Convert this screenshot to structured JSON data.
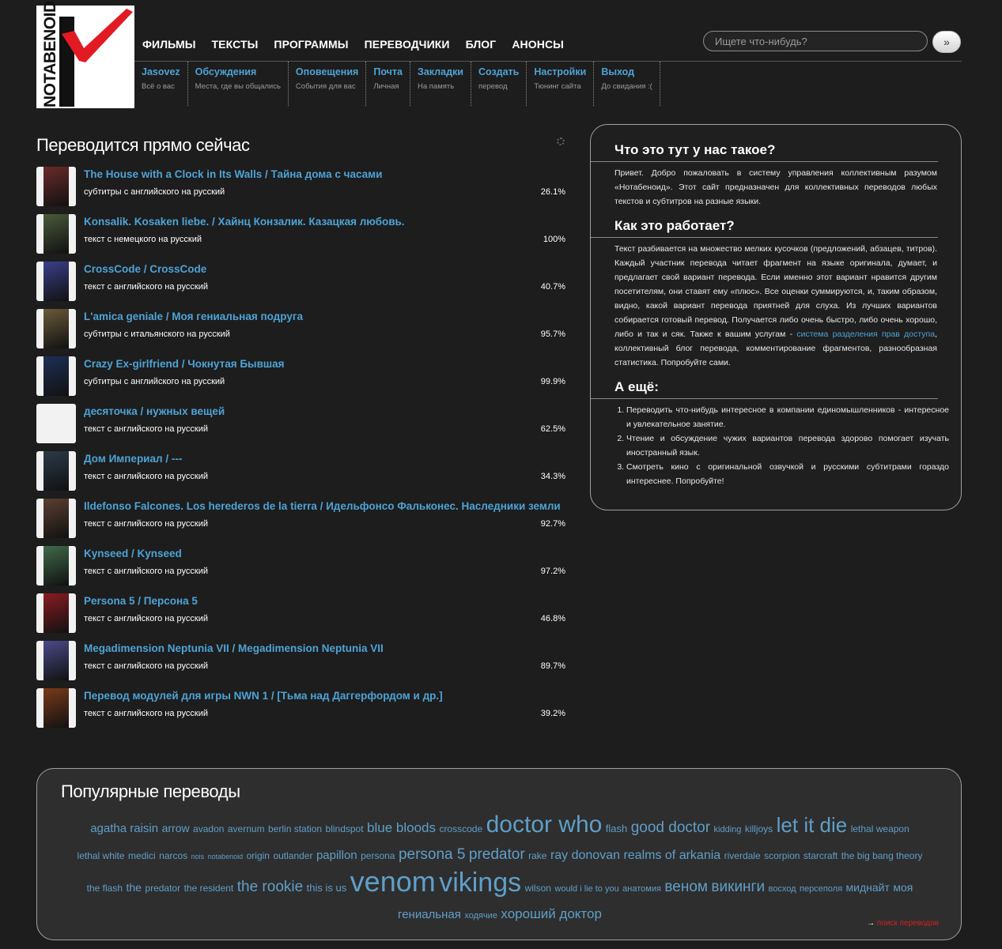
{
  "logo": {
    "text": "NOTABENOID"
  },
  "nav": [
    "ФИЛЬМЫ",
    "ТЕКСТЫ",
    "ПРОГРАММЫ",
    "ПЕРЕВОДЧИКИ",
    "БЛОГ",
    "АНОНСЫ"
  ],
  "search": {
    "placeholder": "Ищете что-нибудь?",
    "button": "»"
  },
  "subnav": [
    {
      "title": "Jasovez",
      "desc": "Всё о вас"
    },
    {
      "title": "Обсуждения",
      "desc": "Места, где вы общались"
    },
    {
      "title": "Оповещения",
      "desc": "События для вас"
    },
    {
      "title": "Почта",
      "desc": "Личная"
    },
    {
      "title": "Закладки",
      "desc": "На память"
    },
    {
      "title": "Создать",
      "desc": "перевод"
    },
    {
      "title": "Настройки",
      "desc": "Тюнинг сайта"
    },
    {
      "title": "Выход",
      "desc": "До свидания :("
    }
  ],
  "translating": {
    "heading": "Переводится прямо сейчас",
    "items": [
      {
        "title": "The House with a Clock in Its Walls / Тайна дома с часами",
        "sub": "субтитры с английского на русский",
        "pct": "26.1%",
        "color": "#6b2a2a"
      },
      {
        "title": "Konsalik. Kosaken liebe. / Хайнц Конзалик. Казацкая любовь.",
        "sub": "текст с немецкого на русский",
        "pct": "100%",
        "color": "#4a5a3a"
      },
      {
        "title": "CrossCode / CrossCode",
        "sub": "текст с английского на русский",
        "pct": "40.7%",
        "color": "#3b3f8a"
      },
      {
        "title": "L'amica geniale / Моя гениальная подруга",
        "sub": "субтитры с итальянского на русский",
        "pct": "95.7%",
        "color": "#6a5a3a"
      },
      {
        "title": "Crazy Ex-girlfriend / Чокнутая Бывшая",
        "sub": "субтитры с английского на русский",
        "pct": "99.9%",
        "color": "#1e2f56"
      },
      {
        "title": "десяточка / нужных вещей",
        "sub": "текст с английского на русский",
        "pct": "62.5%",
        "color": ""
      },
      {
        "title": "Дом Империал / ---",
        "sub": "текст с английского на русский",
        "pct": "34.3%",
        "color": "#2c3a4a"
      },
      {
        "title": "Ildefonso Falcones. Los herederos de la tierra / Идельфонсо Фальконес. Наследники земли",
        "sub": "текст с английского на русский",
        "pct": "92.7%",
        "color": "#5a3f30"
      },
      {
        "title": "Kynseed / Kynseed",
        "sub": "текст с английского на русский",
        "pct": "97.2%",
        "color": "#3f6a4a"
      },
      {
        "title": "Persona 5 / Персона 5",
        "sub": "текст с английского на русский",
        "pct": "46.8%",
        "color": "#8a1c22"
      },
      {
        "title": "Megadimension Neptunia VII / Megadimension Neptunia VII",
        "sub": "текст с английского на русский",
        "pct": "89.7%",
        "color": "#4a4a8a"
      },
      {
        "title": "Перевод модулей для игры NWN 1 / [Тьма над Даггерфордом и др.]",
        "sub": "текст с английского на русский",
        "pct": "39.2%",
        "color": "#7a3a1a"
      }
    ]
  },
  "info": {
    "h1": "Что это тут у нас такое?",
    "p1": "Привет. Добро пожаловать в систему управления коллективным разумом «Нотабеноид». Этот сайт предназначен для коллективных переводов любых текстов и субтитров на разные языки.",
    "h2": "Как это работает?",
    "p2a": "Текст разбивается на множество мелких кусочков (предложений, абзацев, титров). Каждый участник перевода читает фрагмент на языке оригинала, думает, и предлагает свой вариант перевода. Если именно этот вариант нравится другим посетителям, они ставят ему «плюс». Все оценки суммируются, и, таким образом, видно, какой вариант перевода приятней для слуха. Из лучших вариантов собирается готовый перевод. Получается либо очень быстро, либо очень хорошо, либо и так и сяк. Также к вашим услугам -",
    "p2link": "система разделения прав доступа",
    "p2b": ", коллективный блог перевода, комментирование фрагментов, разнообразная статистика. Попробуйте сами.",
    "h3": "А ещё:",
    "list": [
      "Переводить что-нибудь интересное в компании единомышленников - интересное и увлекательное занятие.",
      "Чтение и обсуждение чужих вариантов перевода здорово помогает изучать иностранный язык.",
      "Смотреть кино с оригинальной озвучкой и русскими субтитрами гораздо интереснее. Попробуйте!"
    ]
  },
  "popular": {
    "heading": "Популярные переводы",
    "tags": [
      {
        "t": "agatha raisin",
        "s": 15
      },
      {
        "t": "arrow",
        "s": 14
      },
      {
        "t": "avadon",
        "s": 12
      },
      {
        "t": "avernum",
        "s": 12
      },
      {
        "t": "berlin station",
        "s": 12
      },
      {
        "t": "blindspot",
        "s": 12
      },
      {
        "t": "blue bloods",
        "s": 17
      },
      {
        "t": "crosscode",
        "s": 12
      },
      {
        "t": "doctor who",
        "s": 30
      },
      {
        "t": "flash",
        "s": 13
      },
      {
        "t": "good doctor",
        "s": 19
      },
      {
        "t": "kidding",
        "s": 11
      },
      {
        "t": "killjoys",
        "s": 12
      },
      {
        "t": "let it die",
        "s": 26
      },
      {
        "t": "lethal weapon",
        "s": 12
      },
      {
        "t": "lethal white",
        "s": 12
      },
      {
        "t": "medici",
        "s": 12
      },
      {
        "t": "narcos",
        "s": 12
      },
      {
        "t": "nois",
        "s": 9
      },
      {
        "t": "notabenoid",
        "s": 9
      },
      {
        "t": "origin",
        "s": 12
      },
      {
        "t": "outlander",
        "s": 12
      },
      {
        "t": "papillon",
        "s": 15
      },
      {
        "t": "persona",
        "s": 12
      },
      {
        "t": "persona 5",
        "s": 19
      },
      {
        "t": "predator",
        "s": 19
      },
      {
        "t": "rake",
        "s": 12
      },
      {
        "t": "ray donovan",
        "s": 16
      },
      {
        "t": "realms of arkania",
        "s": 16
      },
      {
        "t": "riverdale",
        "s": 12
      },
      {
        "t": "scorpion",
        "s": 12
      },
      {
        "t": "starcraft",
        "s": 12
      },
      {
        "t": "the big bang theory",
        "s": 12
      },
      {
        "t": "the flash",
        "s": 12
      },
      {
        "t": "the",
        "s": 14
      },
      {
        "t": "predator",
        "s": 12
      },
      {
        "t": "the resident",
        "s": 12
      },
      {
        "t": "the rookie",
        "s": 19
      },
      {
        "t": "this is us",
        "s": 13
      },
      {
        "t": "venom",
        "s": 36
      },
      {
        "t": "vikings",
        "s": 34
      },
      {
        "t": "wilson",
        "s": 12
      },
      {
        "t": "would i lie to you",
        "s": 11
      },
      {
        "t": "анатомия",
        "s": 11
      },
      {
        "t": "веном",
        "s": 19
      },
      {
        "t": "викинги",
        "s": 19
      },
      {
        "t": "восход",
        "s": 11
      },
      {
        "t": "персеполя",
        "s": 11
      },
      {
        "t": "миднайт",
        "s": 14
      },
      {
        "t": "моя",
        "s": 14
      },
      {
        "t": "гениальная",
        "s": 15
      },
      {
        "t": "ходячие",
        "s": 11
      },
      {
        "t": "хороший доктор",
        "s": 17
      }
    ],
    "more_arrow": "→",
    "more_link": "поиск переводов"
  }
}
